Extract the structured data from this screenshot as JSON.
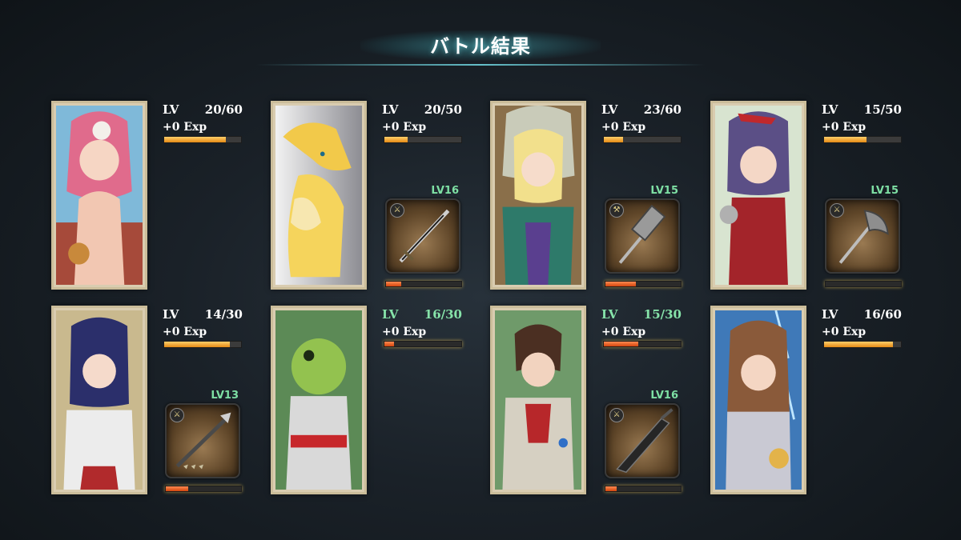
{
  "title": "バトル結果",
  "units": [
    {
      "lv_label": "LV",
      "lv_value": "20/60",
      "exp": "+0 Exp",
      "exp_progress": 0.8,
      "green": false
    },
    {
      "lv_label": "LV",
      "lv_value": "20/50",
      "exp": "+0 Exp",
      "exp_progress": 0.3,
      "green": false,
      "weapon": {
        "lv": "LV16",
        "name_icon": "sword-icon",
        "progress": 0.2
      }
    },
    {
      "lv_label": "LV",
      "lv_value": "23/60",
      "exp": "+0 Exp",
      "exp_progress": 0.25,
      "green": false,
      "weapon": {
        "lv": "LV15",
        "name_icon": "hammer-icon",
        "progress": 0.4
      }
    },
    {
      "lv_label": "LV",
      "lv_value": "15/50",
      "exp": "+0 Exp",
      "exp_progress": 0.55,
      "green": false,
      "weapon": {
        "lv": "LV15",
        "name_icon": "axe-icon",
        "progress": 0.0
      }
    },
    {
      "lv_label": "LV",
      "lv_value": "14/30",
      "exp": "+0 Exp",
      "exp_progress": 0.85,
      "green": false,
      "weapon": {
        "lv": "LV13",
        "name_icon": "spear-icon",
        "progress": 0.3
      }
    },
    {
      "lv_label": "LV",
      "lv_value": "16/30",
      "exp": "+0 Exp",
      "exp_progress": 0.12,
      "green": true
    },
    {
      "lv_label": "LV",
      "lv_value": "15/30",
      "exp": "+0 Exp",
      "exp_progress": 0.45,
      "green": true,
      "weapon": {
        "lv": "LV16",
        "name_icon": "greatsword-icon",
        "progress": 0.15
      }
    },
    {
      "lv_label": "LV",
      "lv_value": "16/60",
      "exp": "+0 Exp",
      "exp_progress": 0.9,
      "green": false
    }
  ]
}
